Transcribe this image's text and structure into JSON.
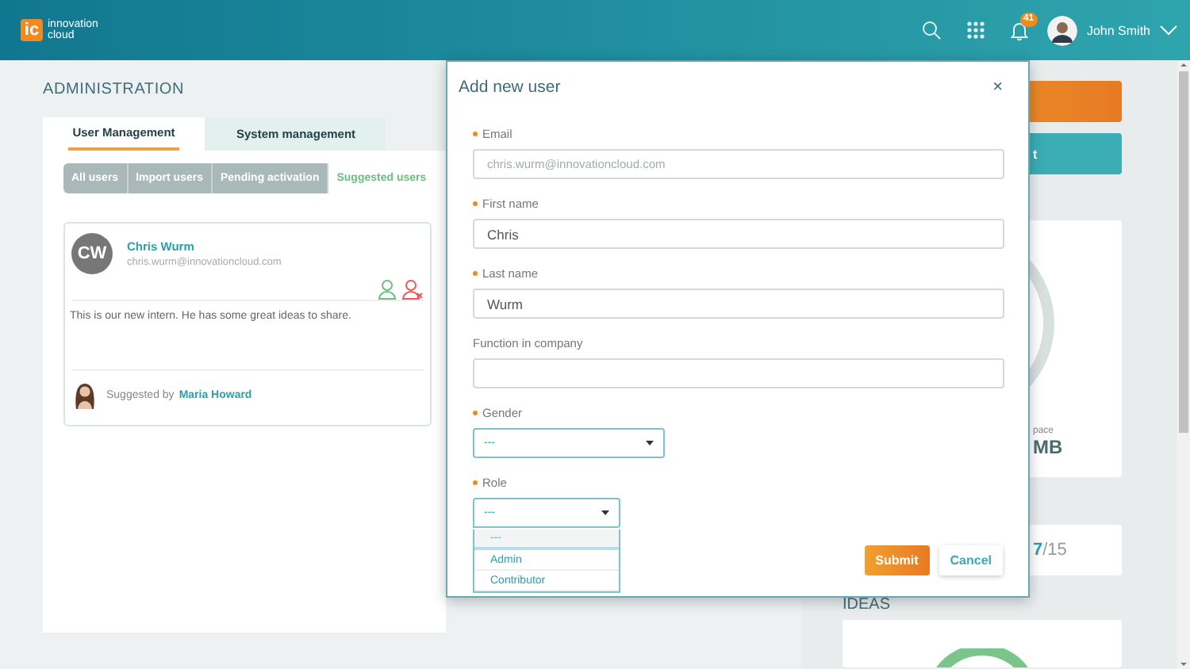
{
  "header": {
    "logo_mark": "ic",
    "logo_text": [
      "innovation",
      "cloud"
    ],
    "notifications_badge": "41",
    "user_name": "John Smith"
  },
  "admin": {
    "title": "ADMINISTRATION",
    "tabs": [
      {
        "label": "User Management",
        "selected": true
      },
      {
        "label": "System management",
        "selected": false
      }
    ],
    "subtabs": [
      {
        "label": "All users",
        "selected": false
      },
      {
        "label": "Import users",
        "selected": false
      },
      {
        "label": "Pending activation",
        "selected": false
      },
      {
        "label": "Suggested users",
        "selected": true
      }
    ],
    "suggestion": {
      "initials": "CW",
      "name": "Chris Wurm",
      "email": "chris.wurm@innovationcloud.com",
      "note": "This is our new intern. He has some great ideas to share.",
      "suggested_by_label": "Suggested by",
      "suggester": "Maria Howard"
    }
  },
  "side": {
    "teal_button_text": "t",
    "storage_label": "pace",
    "storage_value": "MB",
    "count": "**7**/15",
    "ideas_title": "IDEAS"
  },
  "modal": {
    "title": "Add new user",
    "close": "×",
    "fields": [
      {
        "kind": "text",
        "label": "Email",
        "required": true,
        "value": "chris.wurm@innovationcloud.com"
      },
      {
        "kind": "text",
        "label": "First name",
        "required": true,
        "value": "Chris"
      },
      {
        "kind": "text",
        "label": "Last name",
        "required": true,
        "value": "Wurm"
      },
      {
        "kind": "text",
        "label": "Function in company",
        "required": false
      },
      {
        "kind": "select",
        "label": "Gender",
        "required": true,
        "value": "---",
        "open": false
      },
      {
        "kind": "select",
        "label": "Role",
        "required": true,
        "value": "---",
        "open": true,
        "options": [
          {
            "label": "---",
            "selected": true
          },
          {
            "label": "Admin",
            "selected": false
          },
          {
            "label": "Contributor",
            "selected": false
          }
        ]
      }
    ],
    "buttons": [
      {
        "kind": "primary",
        "label": "Submit"
      },
      {
        "kind": "secondary",
        "label": "Cancel"
      }
    ]
  }
}
